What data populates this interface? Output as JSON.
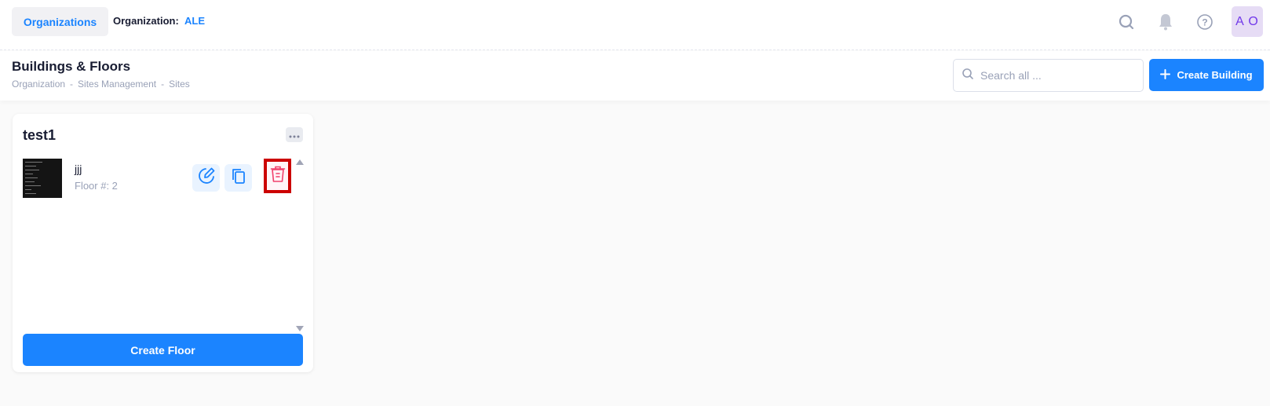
{
  "header": {
    "org_tab_label": "Organizations",
    "org_label": "Organization:",
    "org_value": "ALE",
    "avatar_initials": "A O",
    "icons": [
      "search-icon",
      "bell-icon",
      "help-icon"
    ]
  },
  "toolbar": {
    "title": "Buildings & Floors",
    "breadcrumb": [
      "Organization",
      "-",
      "Sites Management",
      "-",
      "Sites"
    ],
    "search_placeholder": "Search all ...",
    "create_building_label": "Create Building"
  },
  "building": {
    "name": "test1",
    "floors": [
      {
        "name": "jjj",
        "number_label": "Floor #: 2"
      }
    ],
    "create_floor_label": "Create Floor"
  },
  "colors": {
    "accent": "#1b84ff",
    "danger": "#f1416c",
    "highlight": "#cc0000",
    "avatar_text": "#7239ea"
  }
}
